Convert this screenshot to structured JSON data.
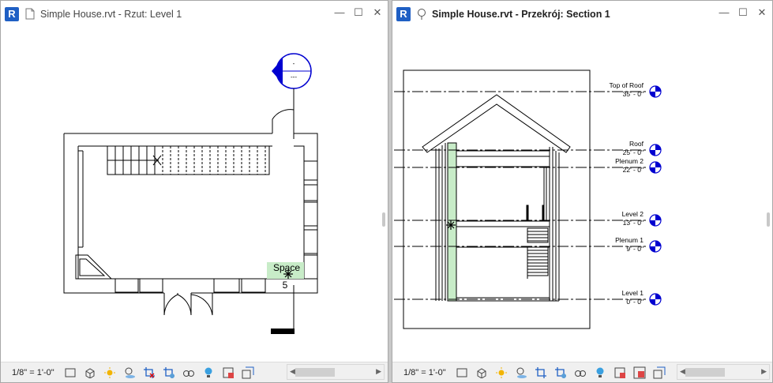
{
  "left_window": {
    "title": "Simple House.rvt - Rzut: Level 1",
    "app_icon": "R",
    "scale": "1/8\" = 1'-0\"",
    "space_label": "Space",
    "space_number": "5",
    "elevation_tag_top": "-",
    "elevation_tag_bottom": "---"
  },
  "right_window": {
    "title": "Simple House.rvt - Przekrój: Section 1",
    "app_icon": "R",
    "scale": "1/8\" = 1'-0\"",
    "levels": [
      {
        "name": "Top of Roof",
        "elevation": "35' - 0\""
      },
      {
        "name": "Roof",
        "elevation": "25' - 0\""
      },
      {
        "name": "Plenum 2",
        "elevation": "22' - 0\""
      },
      {
        "name": "Level 2",
        "elevation": "13' - 0\""
      },
      {
        "name": "Plenum 1",
        "elevation": "9' - 0\""
      },
      {
        "name": "Level 1",
        "elevation": "0' - 0\""
      }
    ]
  },
  "window_buttons": {
    "minimize": "—",
    "maximize": "☐",
    "close": "✕"
  },
  "colors": {
    "revit_blue": "#1f5fc4",
    "tag_blue": "#0000d0",
    "space_fill": "#c8ecc8"
  },
  "status_icons": [
    "detail-level-icon",
    "visual-style-icon",
    "sun-path-icon",
    "shadows-icon",
    "crop-view-icon",
    "show-crop-icon",
    "temporary-hide-icon",
    "reveal-hidden-icon",
    "temporary-view-properties-icon",
    "worksharing-icon",
    "analytical-model-icon"
  ]
}
